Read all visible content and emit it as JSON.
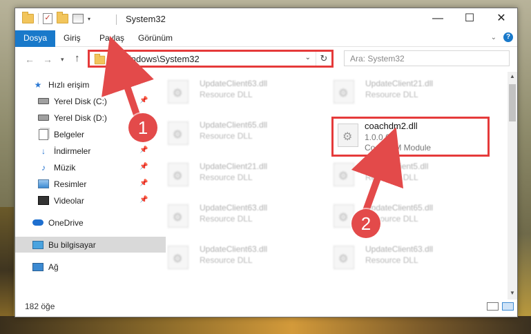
{
  "window": {
    "title": "System32"
  },
  "window_controls": {
    "minimize": "—",
    "maximize": "☐",
    "close": "✕"
  },
  "ribbon": {
    "tabs": [
      "Dosya",
      "Giriş",
      "Paylaş",
      "Görünüm"
    ]
  },
  "address": {
    "path": "C:\\Windows\\System32"
  },
  "search": {
    "placeholder": "Ara: System32"
  },
  "sidebar": {
    "items": [
      {
        "label": "Hızlı erişim",
        "icon": "star-icon",
        "pinned": false
      },
      {
        "label": "Yerel Disk (C:)",
        "icon": "drive-icon",
        "pinned": true
      },
      {
        "label": "Yerel Disk (D:)",
        "icon": "drive-icon",
        "pinned": false
      },
      {
        "label": "Belgeler",
        "icon": "documents-icon",
        "pinned": true
      },
      {
        "label": "İndirmeler",
        "icon": "download-icon",
        "pinned": true
      },
      {
        "label": "Müzik",
        "icon": "music-icon",
        "pinned": true
      },
      {
        "label": "Resimler",
        "icon": "pictures-icon",
        "pinned": true
      },
      {
        "label": "Videolar",
        "icon": "videos-icon",
        "pinned": true
      },
      {
        "label": "OneDrive",
        "icon": "cloud-icon",
        "pinned": false
      },
      {
        "label": "Bu bilgisayar",
        "icon": "computer-icon",
        "pinned": false,
        "selected": true
      },
      {
        "label": "Ağ",
        "icon": "network-icon",
        "pinned": false
      }
    ]
  },
  "files": [
    {
      "name": "UpdateClient63.dll",
      "desc": "Resource DLL"
    },
    {
      "name": "UpdateClient21.dll",
      "desc": "Resource DLL"
    },
    {
      "name": "UpdateClient65.dll",
      "desc": "Resource DLL"
    },
    {
      "name": "coachdm2.dll",
      "version": "1.0.0.6",
      "desc": "CoachDM Module"
    },
    {
      "name": "UpdateClient21.dll",
      "desc": "Resource DLL"
    },
    {
      "name": "UpdateClient5.dll",
      "desc": "Resource DLL"
    },
    {
      "name": "UpdateClient63.dll",
      "desc": "Resource DLL"
    },
    {
      "name": "UpdateClient65.dll",
      "desc": "Resource DLL"
    },
    {
      "name": "UpdateClient63.dll",
      "desc": "Resource DLL"
    },
    {
      "name": "UpdateClient63.dll",
      "desc": "Resource DLL"
    }
  ],
  "status": {
    "count": "182 öğe"
  },
  "markers": [
    "1",
    "2"
  ],
  "colors": {
    "accent": "#1979ca",
    "highlight": "#e53a3a"
  }
}
